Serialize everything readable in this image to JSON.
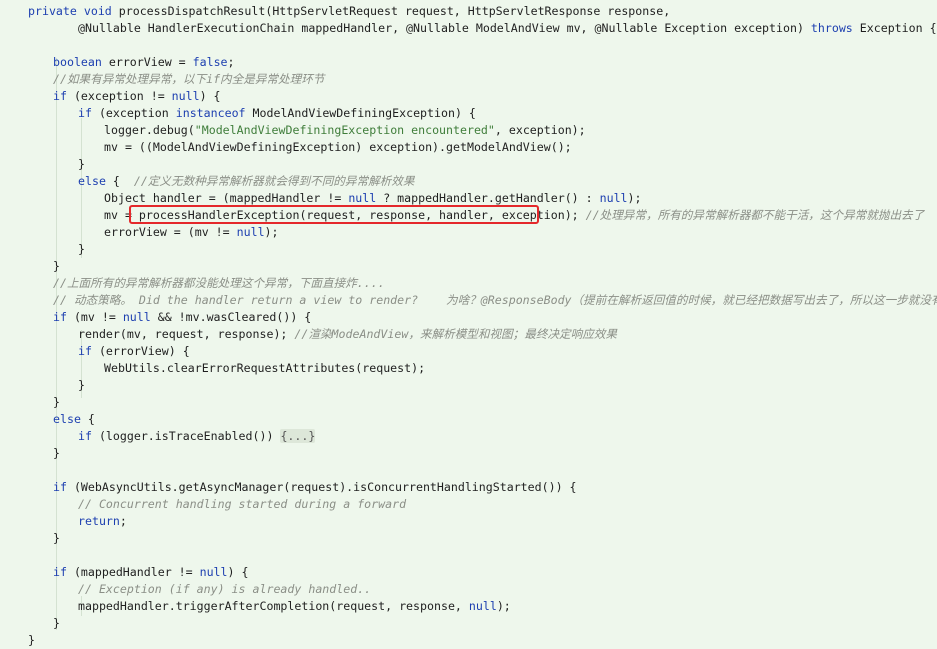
{
  "code": {
    "lines": [
      {
        "segments": [
          {
            "t": "private",
            "c": "kw"
          },
          {
            "t": " "
          },
          {
            "t": "void",
            "c": "kw"
          },
          {
            "t": " processDispatchResult(HttpServletRequest request, HttpServletResponse response,"
          }
        ]
      },
      {
        "segments": [
          {
            "t": "@Nullable HandlerExecutionChain mappedHandler, @Nullable ModelAndView mv, @Nullable Exception exception) "
          },
          {
            "t": "throws",
            "c": "kw"
          },
          {
            "t": " Exception {"
          }
        ]
      },
      {
        "segments": [
          {
            "t": "boolean",
            "c": "kw"
          },
          {
            "t": " errorView = "
          },
          {
            "t": "false",
            "c": "kw"
          },
          {
            "t": ";"
          }
        ]
      },
      {
        "segments": [
          {
            "t": "//如果有异常处理异常，以下if内全是异常处理环节",
            "c": "cm"
          }
        ]
      },
      {
        "segments": [
          {
            "t": "if",
            "c": "kw"
          },
          {
            "t": " (exception != "
          },
          {
            "t": "null",
            "c": "kw"
          },
          {
            "t": ") {"
          }
        ]
      },
      {
        "segments": [
          {
            "t": "if",
            "c": "kw"
          },
          {
            "t": " (exception "
          },
          {
            "t": "instanceof",
            "c": "kw"
          },
          {
            "t": " ModelAndViewDefiningException) {"
          }
        ]
      },
      {
        "segments": [
          {
            "t": "logger.debug("
          },
          {
            "t": "\"ModelAndViewDefiningException encountered\"",
            "c": "str"
          },
          {
            "t": ", exception);"
          }
        ]
      },
      {
        "segments": [
          {
            "t": "mv = ((ModelAndViewDefiningException) exception).getModelAndView();"
          }
        ]
      },
      {
        "segments": [
          {
            "t": "}"
          }
        ]
      },
      {
        "segments": [
          {
            "t": "else",
            "c": "kw"
          },
          {
            "t": " {  "
          },
          {
            "t": "//定义无数种异常解析器就会得到不同的异常解析效果",
            "c": "cm"
          }
        ]
      },
      {
        "segments": [
          {
            "t": "Object handler = (mappedHandler != "
          },
          {
            "t": "null",
            "c": "kw"
          },
          {
            "t": " ? mappedHandler.getHandler() : "
          },
          {
            "t": "null",
            "c": "kw"
          },
          {
            "t": ");"
          }
        ]
      },
      {
        "segments": [
          {
            "t": "mv = "
          },
          {
            "t": "processHandlerException(request, response, handler, exception);"
          },
          {
            "t": " "
          },
          {
            "t": "//处理异常，所有的异常解析器都不能干活，这个异常就抛出去了",
            "c": "cm"
          }
        ]
      },
      {
        "segments": [
          {
            "t": "errorView = (mv != "
          },
          {
            "t": "null",
            "c": "kw"
          },
          {
            "t": ");"
          }
        ]
      },
      {
        "segments": [
          {
            "t": "}"
          }
        ]
      },
      {
        "segments": [
          {
            "t": "}"
          }
        ]
      },
      {
        "segments": [
          {
            "t": "//上面所有的异常解析器都没能处理这个异常，下面直接炸....",
            "c": "cm"
          }
        ]
      },
      {
        "segments": [
          {
            "t": "// 动态策略。 Did the handler return a view to render?    为啥？@ResponseBody（提前在解析返回值的时候，就已经把数据写出去了，所以这一步就没有了）",
            "c": "cm"
          }
        ]
      },
      {
        "segments": [
          {
            "t": "if",
            "c": "kw"
          },
          {
            "t": " (mv != "
          },
          {
            "t": "null",
            "c": "kw"
          },
          {
            "t": " && !mv.wasCleared()) {"
          }
        ]
      },
      {
        "segments": [
          {
            "t": "render(mv, request, response); "
          },
          {
            "t": "//渲染ModeAndView，来解析模型和视图；最终决定响应效果",
            "c": "cm"
          }
        ]
      },
      {
        "segments": [
          {
            "t": "if",
            "c": "kw"
          },
          {
            "t": " (errorView) {"
          }
        ]
      },
      {
        "segments": [
          {
            "t": "WebUtils.clearErrorRequestAttributes(request);"
          }
        ]
      },
      {
        "segments": [
          {
            "t": "}"
          }
        ]
      },
      {
        "segments": [
          {
            "t": "}"
          }
        ]
      },
      {
        "segments": [
          {
            "t": "else",
            "c": "kw"
          },
          {
            "t": " {"
          }
        ]
      },
      {
        "segments": [
          {
            "t": "if",
            "c": "kw"
          },
          {
            "t": " (logger.isTraceEnabled()) "
          },
          {
            "t": "{...}",
            "c": "fold"
          }
        ]
      },
      {
        "segments": [
          {
            "t": "}"
          }
        ]
      },
      {
        "segments": [
          {
            "t": "if",
            "c": "kw"
          },
          {
            "t": " (WebAsyncUtils.getAsyncManager(request).isConcurrentHandlingStarted()) {"
          }
        ]
      },
      {
        "segments": [
          {
            "t": "// Concurrent handling started during a forward",
            "c": "cm"
          }
        ]
      },
      {
        "segments": [
          {
            "t": "return",
            "c": "kw"
          },
          {
            "t": ";"
          }
        ]
      },
      {
        "segments": [
          {
            "t": "}"
          }
        ]
      },
      {
        "segments": [
          {
            "t": "if",
            "c": "kw"
          },
          {
            "t": " (mappedHandler != "
          },
          {
            "t": "null",
            "c": "kw"
          },
          {
            "t": ") {"
          }
        ]
      },
      {
        "segments": [
          {
            "t": "// Exception (if any) is already handled..",
            "c": "cm"
          }
        ]
      },
      {
        "segments": [
          {
            "t": "mappedHandler.triggerAfterCompletion(request, response, "
          },
          {
            "t": "null",
            "c": "kw"
          },
          {
            "t": ");"
          }
        ]
      },
      {
        "segments": [
          {
            "t": "}"
          }
        ]
      },
      {
        "segments": [
          {
            "t": "}"
          }
        ]
      }
    ],
    "highlighted_call": "processHandlerException(request, response, handler, exception);"
  }
}
